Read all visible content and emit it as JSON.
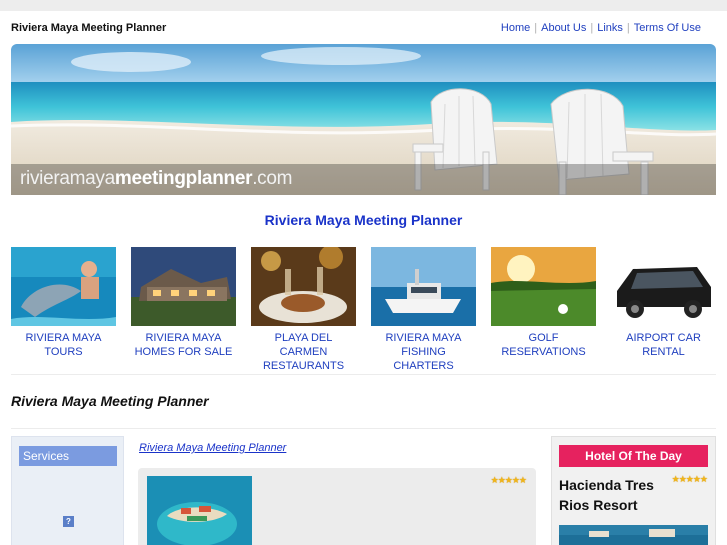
{
  "header": {
    "site_title": "Riviera Maya Meeting Planner",
    "nav": [
      {
        "label": "Home"
      },
      {
        "label": "About Us"
      },
      {
        "label": "Links"
      },
      {
        "label": "Terms Of Use"
      }
    ]
  },
  "banner": {
    "url_prefix": "rivieramaya",
    "url_bold": "meetingplanner",
    "url_suffix": ".com"
  },
  "main": {
    "heading": "Riviera Maya Meeting Planner",
    "tiles": [
      {
        "line1": "RIVIERA MAYA",
        "line2": "TOURS"
      },
      {
        "line1": "RIVIERA MAYA",
        "line2": "HOMES FOR SALE"
      },
      {
        "line1": "PLAYA DEL CARMEN",
        "line2": "RESTAURANTS"
      },
      {
        "line1": "RIVIERA MAYA",
        "line2": "FISHING CHARTERS"
      },
      {
        "line1": "GOLF",
        "line2": "RESERVATIONS"
      },
      {
        "line1": "AIRPORT CAR",
        "line2": "RENTAL"
      }
    ],
    "section_heading": "Riviera Maya Meeting Planner"
  },
  "sidebar": {
    "services_label": "Services",
    "icon": "question-icon"
  },
  "center": {
    "link_text": "Riviera Maya Meeting Planner",
    "stars": "★★★★★"
  },
  "hotel_of_day": {
    "heading": "Hotel Of The Day",
    "name": "Hacienda Tres Rios Resort",
    "stars": "★★★★★"
  },
  "colors": {
    "link_blue": "#1f3fbf",
    "heading_blue": "#1a33c9",
    "services_blue": "#7b9be0",
    "hotd_pink": "#e6225f",
    "star_gold": "#f0b51a"
  }
}
